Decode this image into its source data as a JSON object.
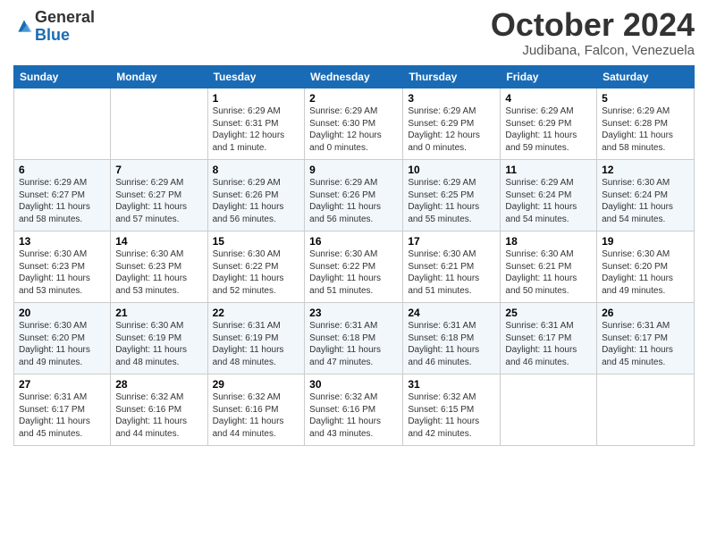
{
  "logo": {
    "general": "General",
    "blue": "Blue"
  },
  "header": {
    "month": "October 2024",
    "location": "Judibana, Falcon, Venezuela"
  },
  "weekdays": [
    "Sunday",
    "Monday",
    "Tuesday",
    "Wednesday",
    "Thursday",
    "Friday",
    "Saturday"
  ],
  "weeks": [
    [
      {
        "day": "",
        "info": ""
      },
      {
        "day": "",
        "info": ""
      },
      {
        "day": "1",
        "info": "Sunrise: 6:29 AM\nSunset: 6:31 PM\nDaylight: 12 hours\nand 1 minute."
      },
      {
        "day": "2",
        "info": "Sunrise: 6:29 AM\nSunset: 6:30 PM\nDaylight: 12 hours\nand 0 minutes."
      },
      {
        "day": "3",
        "info": "Sunrise: 6:29 AM\nSunset: 6:29 PM\nDaylight: 12 hours\nand 0 minutes."
      },
      {
        "day": "4",
        "info": "Sunrise: 6:29 AM\nSunset: 6:29 PM\nDaylight: 11 hours\nand 59 minutes."
      },
      {
        "day": "5",
        "info": "Sunrise: 6:29 AM\nSunset: 6:28 PM\nDaylight: 11 hours\nand 58 minutes."
      }
    ],
    [
      {
        "day": "6",
        "info": "Sunrise: 6:29 AM\nSunset: 6:27 PM\nDaylight: 11 hours\nand 58 minutes."
      },
      {
        "day": "7",
        "info": "Sunrise: 6:29 AM\nSunset: 6:27 PM\nDaylight: 11 hours\nand 57 minutes."
      },
      {
        "day": "8",
        "info": "Sunrise: 6:29 AM\nSunset: 6:26 PM\nDaylight: 11 hours\nand 56 minutes."
      },
      {
        "day": "9",
        "info": "Sunrise: 6:29 AM\nSunset: 6:26 PM\nDaylight: 11 hours\nand 56 minutes."
      },
      {
        "day": "10",
        "info": "Sunrise: 6:29 AM\nSunset: 6:25 PM\nDaylight: 11 hours\nand 55 minutes."
      },
      {
        "day": "11",
        "info": "Sunrise: 6:29 AM\nSunset: 6:24 PM\nDaylight: 11 hours\nand 54 minutes."
      },
      {
        "day": "12",
        "info": "Sunrise: 6:30 AM\nSunset: 6:24 PM\nDaylight: 11 hours\nand 54 minutes."
      }
    ],
    [
      {
        "day": "13",
        "info": "Sunrise: 6:30 AM\nSunset: 6:23 PM\nDaylight: 11 hours\nand 53 minutes."
      },
      {
        "day": "14",
        "info": "Sunrise: 6:30 AM\nSunset: 6:23 PM\nDaylight: 11 hours\nand 53 minutes."
      },
      {
        "day": "15",
        "info": "Sunrise: 6:30 AM\nSunset: 6:22 PM\nDaylight: 11 hours\nand 52 minutes."
      },
      {
        "day": "16",
        "info": "Sunrise: 6:30 AM\nSunset: 6:22 PM\nDaylight: 11 hours\nand 51 minutes."
      },
      {
        "day": "17",
        "info": "Sunrise: 6:30 AM\nSunset: 6:21 PM\nDaylight: 11 hours\nand 51 minutes."
      },
      {
        "day": "18",
        "info": "Sunrise: 6:30 AM\nSunset: 6:21 PM\nDaylight: 11 hours\nand 50 minutes."
      },
      {
        "day": "19",
        "info": "Sunrise: 6:30 AM\nSunset: 6:20 PM\nDaylight: 11 hours\nand 49 minutes."
      }
    ],
    [
      {
        "day": "20",
        "info": "Sunrise: 6:30 AM\nSunset: 6:20 PM\nDaylight: 11 hours\nand 49 minutes."
      },
      {
        "day": "21",
        "info": "Sunrise: 6:30 AM\nSunset: 6:19 PM\nDaylight: 11 hours\nand 48 minutes."
      },
      {
        "day": "22",
        "info": "Sunrise: 6:31 AM\nSunset: 6:19 PM\nDaylight: 11 hours\nand 48 minutes."
      },
      {
        "day": "23",
        "info": "Sunrise: 6:31 AM\nSunset: 6:18 PM\nDaylight: 11 hours\nand 47 minutes."
      },
      {
        "day": "24",
        "info": "Sunrise: 6:31 AM\nSunset: 6:18 PM\nDaylight: 11 hours\nand 46 minutes."
      },
      {
        "day": "25",
        "info": "Sunrise: 6:31 AM\nSunset: 6:17 PM\nDaylight: 11 hours\nand 46 minutes."
      },
      {
        "day": "26",
        "info": "Sunrise: 6:31 AM\nSunset: 6:17 PM\nDaylight: 11 hours\nand 45 minutes."
      }
    ],
    [
      {
        "day": "27",
        "info": "Sunrise: 6:31 AM\nSunset: 6:17 PM\nDaylight: 11 hours\nand 45 minutes."
      },
      {
        "day": "28",
        "info": "Sunrise: 6:32 AM\nSunset: 6:16 PM\nDaylight: 11 hours\nand 44 minutes."
      },
      {
        "day": "29",
        "info": "Sunrise: 6:32 AM\nSunset: 6:16 PM\nDaylight: 11 hours\nand 44 minutes."
      },
      {
        "day": "30",
        "info": "Sunrise: 6:32 AM\nSunset: 6:16 PM\nDaylight: 11 hours\nand 43 minutes."
      },
      {
        "day": "31",
        "info": "Sunrise: 6:32 AM\nSunset: 6:15 PM\nDaylight: 11 hours\nand 42 minutes."
      },
      {
        "day": "",
        "info": ""
      },
      {
        "day": "",
        "info": ""
      }
    ]
  ]
}
